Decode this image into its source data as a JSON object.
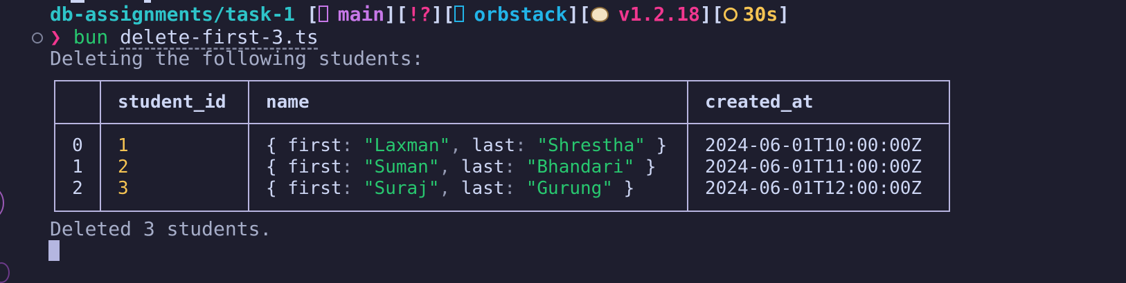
{
  "prompt": {
    "path": "db-assignments/task-1",
    "branch": "main",
    "git_status": "[!?]",
    "context": "orbstack",
    "bun_version": "v1.2.18",
    "duration": "30s",
    "symbol": "❯",
    "command": "bun",
    "command_arg": "delete-first-3.ts"
  },
  "output": {
    "heading": "Deleting the following students:",
    "footer": "Deleted 3 students."
  },
  "table": {
    "columns": [
      "",
      "student_id",
      "name",
      "created_at"
    ],
    "rows": [
      {
        "index": "0",
        "student_id": "1",
        "first": "Laxman",
        "last": "Shrestha",
        "created_at": "2024-06-01T10:00:00Z"
      },
      {
        "index": "1",
        "student_id": "2",
        "first": "Suman",
        "last": "Bhandari",
        "created_at": "2024-06-01T11:00:00Z"
      },
      {
        "index": "2",
        "student_id": "3",
        "first": "Suraj",
        "last": "Gurung",
        "created_at": "2024-06-01T12:00:00Z"
      }
    ]
  },
  "icons": {
    "branch": "git-branch-icon",
    "context": "docker-context-icon",
    "bun": "bun-icon",
    "clock": "stopwatch-icon"
  },
  "colors": {
    "background": "#1e1e2e",
    "path": "#2ec4c9",
    "branch": "#c778e8",
    "status": "#f0378f",
    "context": "#22b4e8",
    "version": "#f0378f",
    "duration": "#f6c453",
    "string": "#28c76f",
    "number": "#f6c453",
    "border": "#b8b5e0"
  }
}
